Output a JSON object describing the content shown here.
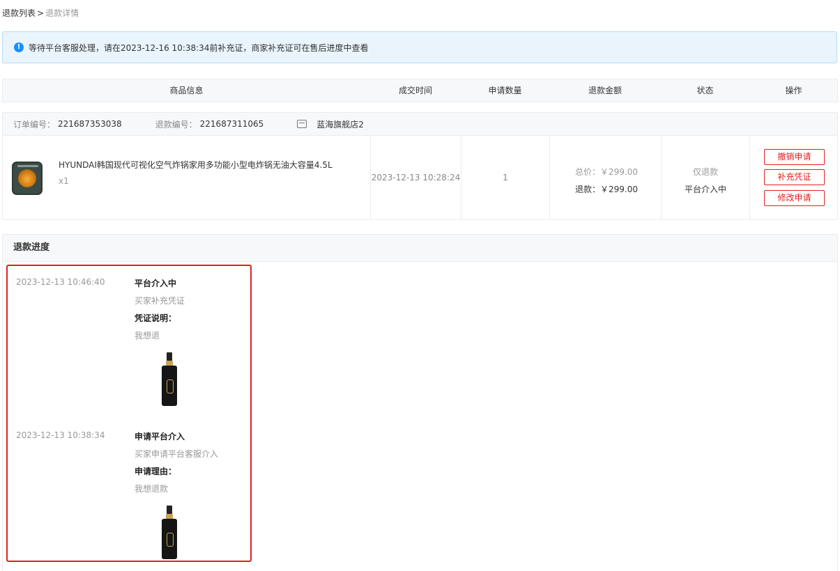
{
  "breadcrumb": {
    "list": "退款列表",
    "separator": ">",
    "current": "退款详情"
  },
  "notice": {
    "icon": "info-icon",
    "text": "等待平台客服处理，请在2023-12-16 10:38:34前补充证，商家补充证可在售后进度中查看"
  },
  "table_headers": [
    "商品信息",
    "成交时间",
    "申请数量",
    "退款金额",
    "状态",
    "操作"
  ],
  "order": {
    "order_no_label": "订单编号：",
    "order_no": "221687353038",
    "refund_no_label": "退款编号：",
    "refund_no": "221687311065",
    "store_icon": "store-icon",
    "store_name": "蓝海旗舰店2",
    "product_name": "HYUNDAI韩国现代可视化空气炸锅家用多功能小型电炸锅无油大容量4.5L",
    "product_qty": "x1",
    "deal_time": "2023-12-13 10:28:24",
    "apply_qty": "1",
    "total_label": "总价：",
    "total_value": "￥299.00",
    "refund_label": "退款：",
    "refund_value": "￥299.00",
    "status_type": "仅退款",
    "status_text": "平台介入中",
    "actions": {
      "cancel": "撤销申请",
      "supplement": "补充凭证",
      "modify": "修改申请"
    }
  },
  "progress": {
    "title": "退款进度",
    "events": [
      {
        "time": "2023-12-13 10:46:40",
        "title": "平台介入中",
        "desc": "买家补充凭证",
        "sub_label": "凭证说明：",
        "note": "我想退"
      },
      {
        "time": "2023-12-13 10:38:34",
        "title": "申请平台介入",
        "desc": "买家申请平台客服介入",
        "sub_label": "申请理由：",
        "note": "我想退款"
      }
    ]
  },
  "colors": {
    "accent_red": "#e02020",
    "info_blue": "#1890ff",
    "notice_bg": "#e9f4fd"
  }
}
